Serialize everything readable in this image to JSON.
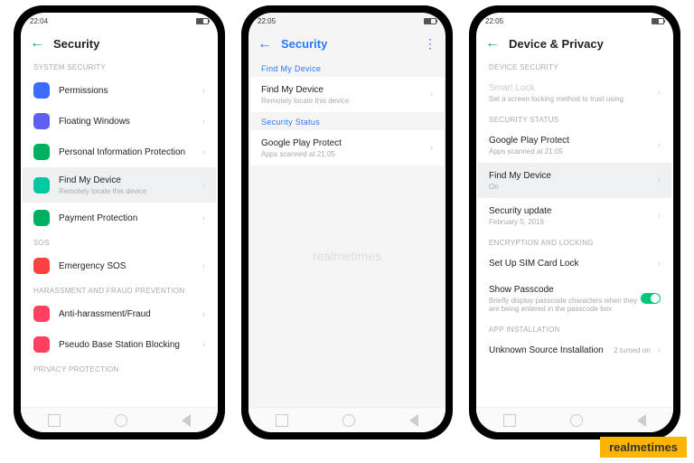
{
  "statusbar": {
    "time1": "22:04",
    "time2": "22:05",
    "time3": "22:05"
  },
  "p1": {
    "title": "Security",
    "sections": [
      {
        "label": "SYSTEM SECURITY",
        "items": [
          {
            "icon": "#3b6bff",
            "name": "permissions",
            "title": "Permissions"
          },
          {
            "icon": "#5d5fef",
            "name": "floating-windows",
            "title": "Floating Windows"
          },
          {
            "icon": "#00b060",
            "name": "personal-info",
            "title": "Personal Information Protection"
          },
          {
            "icon": "#00c8a0",
            "name": "find-my-device",
            "title": "Find My Device",
            "sub": "Remotely locate this device",
            "hl": true
          },
          {
            "icon": "#00b060",
            "name": "payment-protection",
            "title": "Payment Protection"
          }
        ]
      },
      {
        "label": "SOS",
        "items": [
          {
            "icon": "#ff4040",
            "name": "emergency-sos",
            "title": "Emergency SOS"
          }
        ]
      },
      {
        "label": "HARASSMENT AND FRAUD PREVENTION",
        "items": [
          {
            "icon": "#ff4060",
            "name": "anti-harassment",
            "title": "Anti-harassment/Fraud"
          },
          {
            "icon": "#ff4060",
            "name": "pseudo-base",
            "title": "Pseudo Base Station Blocking"
          }
        ]
      },
      {
        "label": "PRIVACY PROTECTION",
        "items": []
      }
    ]
  },
  "p2": {
    "title": "Security",
    "sections": [
      {
        "label": "Find My Device",
        "items": [
          {
            "name": "find-my-device",
            "title": "Find My Device",
            "sub": "Remotely locate this device"
          }
        ]
      },
      {
        "label": "Security Status",
        "items": [
          {
            "name": "google-play-protect",
            "title": "Google Play Protect",
            "sub": "Apps scanned at 21:05"
          }
        ]
      }
    ]
  },
  "p3": {
    "title": "Device & Privacy",
    "sections": [
      {
        "label": "DEVICE SECURITY",
        "items": [
          {
            "name": "smart-lock",
            "title": "Smart Lock",
            "sub": "Set a screen locking method to trust using",
            "faded": true
          }
        ]
      },
      {
        "label": "SECURITY STATUS",
        "items": [
          {
            "name": "google-play-protect",
            "title": "Google Play Protect",
            "sub": "Apps scanned at 21:05"
          },
          {
            "name": "find-my-device",
            "title": "Find My Device",
            "sub": "On",
            "hl": true
          },
          {
            "name": "security-update",
            "title": "Security update",
            "sub": "February 5, 2019"
          }
        ]
      },
      {
        "label": "ENCRYPTION AND LOCKING",
        "items": [
          {
            "name": "sim-lock",
            "title": "Set Up SIM Card Lock"
          },
          {
            "name": "show-passcode",
            "title": "Show Passcode",
            "sub": "Briefly display passcode characters when they are being entered in the passcode box",
            "toggle": true
          }
        ]
      },
      {
        "label": "APP INSTALLATION",
        "items": [
          {
            "name": "unknown-source",
            "title": "Unknown Source Installation",
            "val": "2 turned on"
          }
        ]
      }
    ]
  },
  "watermark": "realmetimes",
  "brand": "realmetimes"
}
